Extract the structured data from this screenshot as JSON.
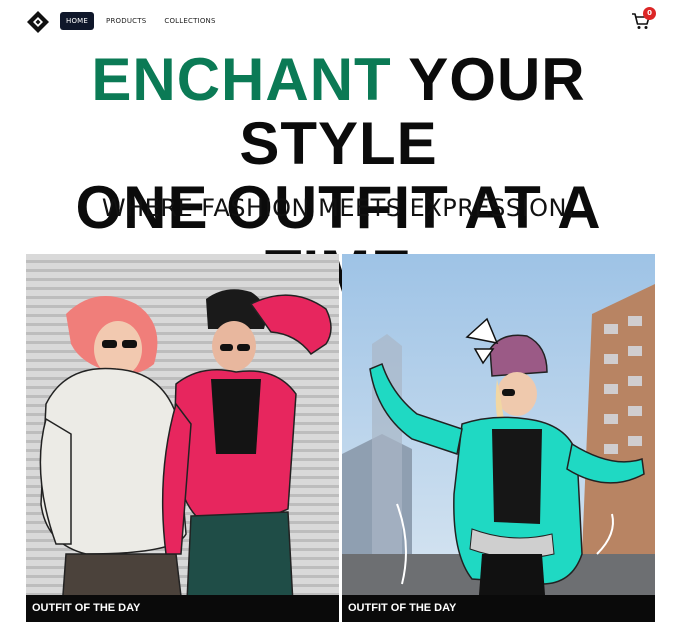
{
  "nav": {
    "links": [
      {
        "label": "HOME",
        "active": true
      },
      {
        "label": "PRODUCTS",
        "active": false
      },
      {
        "label": "COLLECTIONS",
        "active": false
      }
    ],
    "cart_count": "0"
  },
  "hero": {
    "line1_accent": "ENCHANT",
    "line1_rest": " YOUR STYLE",
    "line2": "ONE OUTFIT AT A TIME",
    "subtitle": "WHERE FASHION MEETS EXPRESSION."
  },
  "cards": [
    {
      "caption": "OUTFIT OF THE DAY"
    },
    {
      "caption": "OUTFIT OF THE DAY"
    }
  ],
  "colors": {
    "accent": "#0b7a55",
    "nav_active_bg": "#0f172a",
    "badge": "#dc2626",
    "caption_bg": "#0a0a0a"
  },
  "icons": {
    "logo": "diamond-logo-icon",
    "cart": "shopping-cart-icon"
  }
}
